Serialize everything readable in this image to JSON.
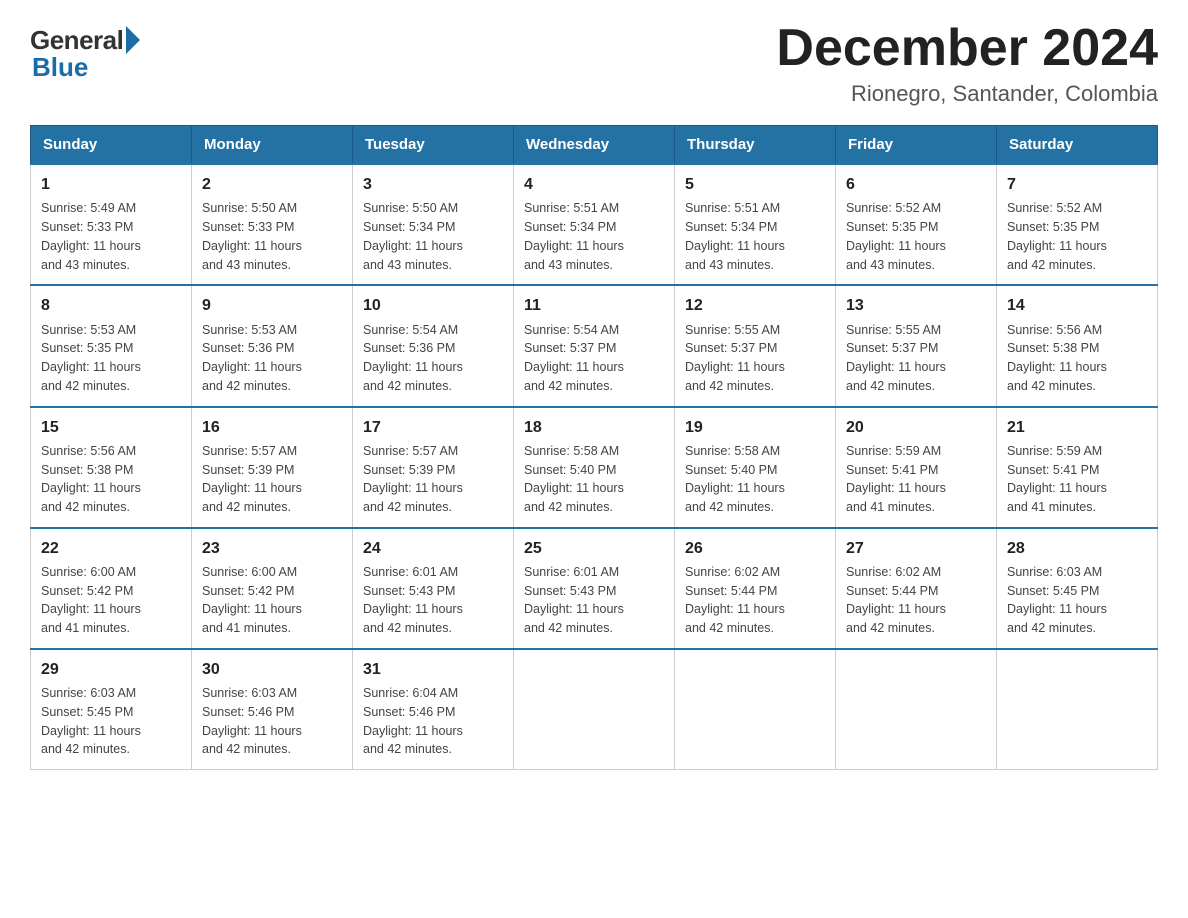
{
  "header": {
    "logo_general": "General",
    "logo_blue": "Blue",
    "month_title": "December 2024",
    "location": "Rionegro, Santander, Colombia"
  },
  "days_of_week": [
    "Sunday",
    "Monday",
    "Tuesday",
    "Wednesday",
    "Thursday",
    "Friday",
    "Saturday"
  ],
  "weeks": [
    [
      {
        "day": "1",
        "sunrise": "5:49 AM",
        "sunset": "5:33 PM",
        "daylight": "11 hours and 43 minutes."
      },
      {
        "day": "2",
        "sunrise": "5:50 AM",
        "sunset": "5:33 PM",
        "daylight": "11 hours and 43 minutes."
      },
      {
        "day": "3",
        "sunrise": "5:50 AM",
        "sunset": "5:34 PM",
        "daylight": "11 hours and 43 minutes."
      },
      {
        "day": "4",
        "sunrise": "5:51 AM",
        "sunset": "5:34 PM",
        "daylight": "11 hours and 43 minutes."
      },
      {
        "day": "5",
        "sunrise": "5:51 AM",
        "sunset": "5:34 PM",
        "daylight": "11 hours and 43 minutes."
      },
      {
        "day": "6",
        "sunrise": "5:52 AM",
        "sunset": "5:35 PM",
        "daylight": "11 hours and 43 minutes."
      },
      {
        "day": "7",
        "sunrise": "5:52 AM",
        "sunset": "5:35 PM",
        "daylight": "11 hours and 42 minutes."
      }
    ],
    [
      {
        "day": "8",
        "sunrise": "5:53 AM",
        "sunset": "5:35 PM",
        "daylight": "11 hours and 42 minutes."
      },
      {
        "day": "9",
        "sunrise": "5:53 AM",
        "sunset": "5:36 PM",
        "daylight": "11 hours and 42 minutes."
      },
      {
        "day": "10",
        "sunrise": "5:54 AM",
        "sunset": "5:36 PM",
        "daylight": "11 hours and 42 minutes."
      },
      {
        "day": "11",
        "sunrise": "5:54 AM",
        "sunset": "5:37 PM",
        "daylight": "11 hours and 42 minutes."
      },
      {
        "day": "12",
        "sunrise": "5:55 AM",
        "sunset": "5:37 PM",
        "daylight": "11 hours and 42 minutes."
      },
      {
        "day": "13",
        "sunrise": "5:55 AM",
        "sunset": "5:37 PM",
        "daylight": "11 hours and 42 minutes."
      },
      {
        "day": "14",
        "sunrise": "5:56 AM",
        "sunset": "5:38 PM",
        "daylight": "11 hours and 42 minutes."
      }
    ],
    [
      {
        "day": "15",
        "sunrise": "5:56 AM",
        "sunset": "5:38 PM",
        "daylight": "11 hours and 42 minutes."
      },
      {
        "day": "16",
        "sunrise": "5:57 AM",
        "sunset": "5:39 PM",
        "daylight": "11 hours and 42 minutes."
      },
      {
        "day": "17",
        "sunrise": "5:57 AM",
        "sunset": "5:39 PM",
        "daylight": "11 hours and 42 minutes."
      },
      {
        "day": "18",
        "sunrise": "5:58 AM",
        "sunset": "5:40 PM",
        "daylight": "11 hours and 42 minutes."
      },
      {
        "day": "19",
        "sunrise": "5:58 AM",
        "sunset": "5:40 PM",
        "daylight": "11 hours and 42 minutes."
      },
      {
        "day": "20",
        "sunrise": "5:59 AM",
        "sunset": "5:41 PM",
        "daylight": "11 hours and 41 minutes."
      },
      {
        "day": "21",
        "sunrise": "5:59 AM",
        "sunset": "5:41 PM",
        "daylight": "11 hours and 41 minutes."
      }
    ],
    [
      {
        "day": "22",
        "sunrise": "6:00 AM",
        "sunset": "5:42 PM",
        "daylight": "11 hours and 41 minutes."
      },
      {
        "day": "23",
        "sunrise": "6:00 AM",
        "sunset": "5:42 PM",
        "daylight": "11 hours and 41 minutes."
      },
      {
        "day": "24",
        "sunrise": "6:01 AM",
        "sunset": "5:43 PM",
        "daylight": "11 hours and 42 minutes."
      },
      {
        "day": "25",
        "sunrise": "6:01 AM",
        "sunset": "5:43 PM",
        "daylight": "11 hours and 42 minutes."
      },
      {
        "day": "26",
        "sunrise": "6:02 AM",
        "sunset": "5:44 PM",
        "daylight": "11 hours and 42 minutes."
      },
      {
        "day": "27",
        "sunrise": "6:02 AM",
        "sunset": "5:44 PM",
        "daylight": "11 hours and 42 minutes."
      },
      {
        "day": "28",
        "sunrise": "6:03 AM",
        "sunset": "5:45 PM",
        "daylight": "11 hours and 42 minutes."
      }
    ],
    [
      {
        "day": "29",
        "sunrise": "6:03 AM",
        "sunset": "5:45 PM",
        "daylight": "11 hours and 42 minutes."
      },
      {
        "day": "30",
        "sunrise": "6:03 AM",
        "sunset": "5:46 PM",
        "daylight": "11 hours and 42 minutes."
      },
      {
        "day": "31",
        "sunrise": "6:04 AM",
        "sunset": "5:46 PM",
        "daylight": "11 hours and 42 minutes."
      },
      null,
      null,
      null,
      null
    ]
  ],
  "labels": {
    "sunrise": "Sunrise:",
    "sunset": "Sunset:",
    "daylight": "Daylight:"
  }
}
